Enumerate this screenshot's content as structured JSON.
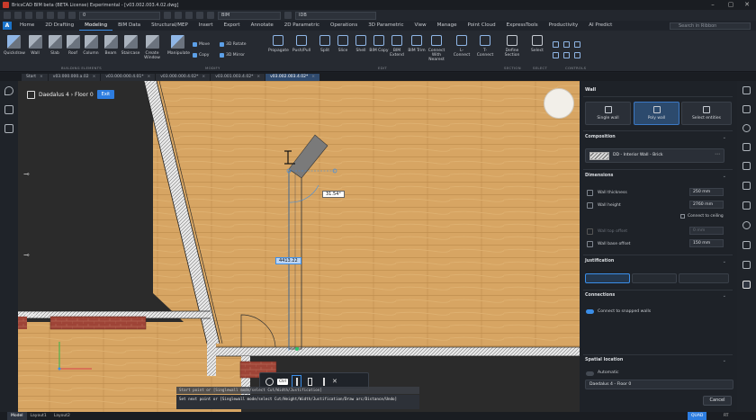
{
  "window": {
    "title": "BricsCAD BIM beta (BETA License) Experimental - [v03.002.003.4.02.dwg]"
  },
  "qat": {
    "layer_value": "0",
    "layer2_value": "BIM",
    "linetype_value": "IDB"
  },
  "menu": {
    "tabs": [
      "Home",
      "2D Drafting",
      "Modeling",
      "BIM Data",
      "Structural/MEP",
      "Insert",
      "Export",
      "Annotate",
      "2D Parametric",
      "Operations",
      "3D Parametric",
      "View",
      "Manage",
      "Point Cloud",
      "ExpressTools",
      "Productivity",
      "AI Predict"
    ],
    "active": "Modeling",
    "search_placeholder": "Search in Ribbon"
  },
  "ribbon": {
    "tools": [
      "Quickdraw",
      "Wall",
      "Slab",
      "Roof",
      "Column",
      "Beam",
      "Staircase",
      "Create Window",
      "Manipulate"
    ],
    "modify_small": [
      "Move",
      "Copy",
      "3D Rotate",
      "3D Mirror"
    ],
    "edit_tools": [
      "Propagate",
      "Push/Pull",
      "Split",
      "Slice",
      "Shell",
      "BIM Copy",
      "BIM Extend",
      "BIM Trim",
      "Connect With Nearest",
      "L-Connect",
      "T-Connect"
    ],
    "section_tools": [
      "Define Section",
      "Select"
    ],
    "groups": [
      "BUILDING ELEMENTS",
      "MODIFY",
      "EDIT",
      "SECTION",
      "SELECT",
      "CONTROLS"
    ]
  },
  "doc_tabs": [
    {
      "label": "Start",
      "active": false
    },
    {
      "label": "v03.000.000.a.02",
      "active": false
    },
    {
      "label": "v03.000.000.4.01*",
      "active": false
    },
    {
      "label": "v03.000.000.4.02*",
      "active": false
    },
    {
      "label": "v03.001.003.4.02*",
      "active": false
    },
    {
      "label": "v03.002.003.4.02*",
      "active": true
    }
  ],
  "viewport": {
    "breadcrumb": "Daedalus 4 › Floor 0",
    "exit_label": "Exit",
    "angle_label": "31.54°",
    "length_label": "4413.22",
    "floor_label": "Floor 0",
    "hud_labels": [
      "Ctrl"
    ],
    "cmd_line1": "Start point or [Singlewall mode/select Cut/Width/Justification]",
    "cmd_line2": "Set next point or [Singlewall mode/select Cut/Height/Width/Justification/Draw arc/Distance/Undo]"
  },
  "panel": {
    "title": "Wall",
    "modes": [
      {
        "label": "Single wall",
        "active": false
      },
      {
        "label": "Poly wall",
        "active": true
      },
      {
        "label": "Select entities",
        "active": false
      }
    ],
    "composition": {
      "heading": "Composition",
      "value": "DD - Interior Wall - Brick"
    },
    "dimensions": {
      "heading": "Dimensions",
      "wall_thickness_label": "Wall thickness",
      "wall_thickness_value": "250 mm",
      "wall_height_label": "Wall height",
      "wall_height_value": "2760 mm",
      "connect_ceiling_label": "Connect to ceiling",
      "wall_top_offset_label": "Wall top offset",
      "wall_top_offset_value": "0 mm",
      "wall_base_offset_label": "Wall base offset",
      "wall_base_offset_value": "150 mm"
    },
    "justification": {
      "heading": "Justification"
    },
    "connections": {
      "heading": "Connections",
      "connect_label": "Connect to snapped walls"
    },
    "spatial": {
      "heading": "Spatial location",
      "automatic_label": "Automatic",
      "location_value": "Daedalus 4 - Floor 0"
    },
    "cancel_label": "Cancel"
  },
  "status": {
    "tabs": [
      "Model",
      "Layout1",
      "Layout2"
    ],
    "active": "Model",
    "right1": "QUAD",
    "right2": "RT"
  },
  "colors": {
    "accent": "#3b8ee8",
    "wood": "#d9a864",
    "brick": "#a8463b"
  }
}
